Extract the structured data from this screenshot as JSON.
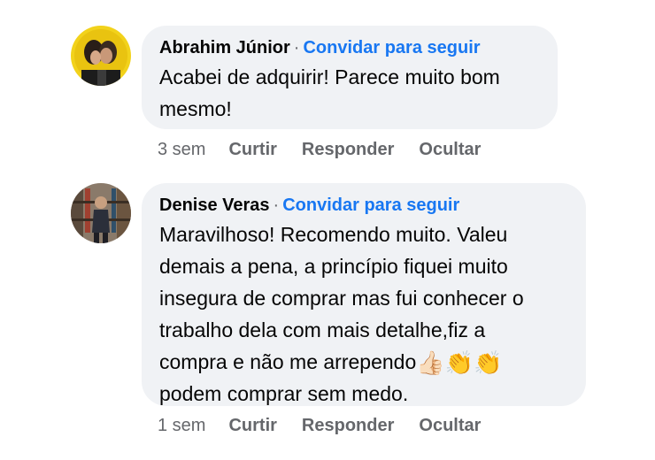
{
  "comments": [
    {
      "author": "Abrahim Júnior",
      "separator": "·",
      "invite_label": "Convidar para seguir",
      "text_lines": [
        "Acabei de adquirir! Parece muito bom",
        "mesmo!"
      ],
      "time": "3 sem",
      "like_label": "Curtir",
      "reply_label": "Responder",
      "hide_label": "Ocultar"
    },
    {
      "author": "Denise Veras",
      "separator": "·",
      "invite_label": "Convidar para seguir",
      "text_lines": [
        "Maravilhoso! Recomendo muito. Valeu",
        "demais a pena, a princípio fiquei muito",
        "insegura de comprar mas fui conhecer o",
        "trabalho dela com mais detalhe,fiz a",
        "compra e não me arrependo"
      ],
      "emojis": [
        "👍🏻",
        "👏",
        "👏"
      ],
      "text_last": "podem comprar sem medo.",
      "time": "1 sem",
      "like_label": "Curtir",
      "reply_label": "Responder",
      "hide_label": "Ocultar"
    }
  ],
  "colors": {
    "bubble": "#f0f2f5",
    "link": "#1877f2",
    "meta": "#65676b",
    "text": "#050505"
  },
  "icons": [
    "thumbs-up-emoji",
    "clapping-hands-emoji"
  ]
}
